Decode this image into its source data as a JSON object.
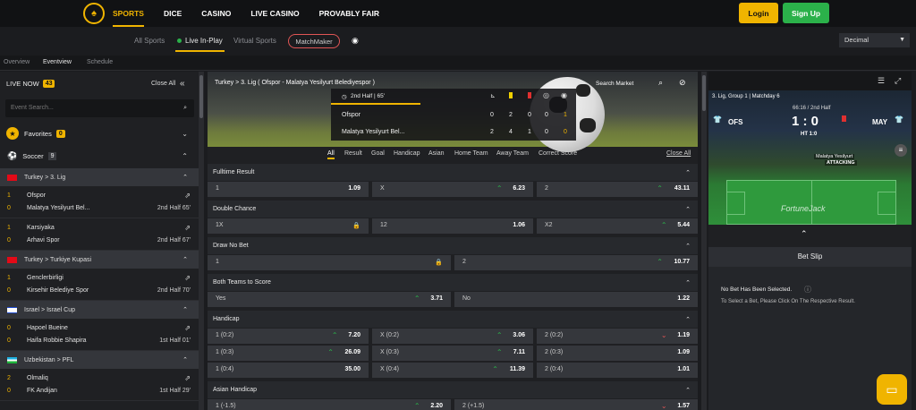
{
  "topnav": {
    "items": [
      "SPORTS",
      "DICE",
      "CASINO",
      "LIVE CASINO",
      "PROVABLY FAIR"
    ],
    "login": "Login",
    "signup": "Sign Up"
  },
  "subnav": {
    "all_sports": "All Sports",
    "live": "Live In-Play",
    "virtual": "Virtual Sports",
    "matchmaker": "MatchMaker",
    "odds_format": "Decimal"
  },
  "viewtabs": {
    "overview": "Overview",
    "eventview": "Eventview",
    "schedule": "Schedule"
  },
  "left": {
    "live_now": "LIVE NOW",
    "live_count": "43",
    "close_all": "Close All",
    "search_placeholder": "Event Search...",
    "favorites": "Favorites",
    "favorites_count": "0",
    "soccer": "Soccer",
    "soccer_count": "9",
    "leagues": [
      {
        "name": "Turkey > 3. Lig",
        "matches": [
          {
            "home": "Ofspor",
            "away": "Malatya Yesilyurt Bel...",
            "hs": "1",
            "as": "0",
            "status": "2nd Half  65'"
          },
          {
            "home": "Karsiyaka",
            "away": "Arhavi Spor",
            "hs": "1",
            "as": "0",
            "status": "2nd Half  67'"
          }
        ]
      },
      {
        "name": "Turkey > Turkiye Kupasi",
        "matches": [
          {
            "home": "Genclerbirligi",
            "away": "Kirsehir Belediye Spor",
            "hs": "1",
            "as": "0",
            "status": "2nd Half  70'"
          }
        ]
      },
      {
        "name": "Israel > Israel Cup",
        "matches": [
          {
            "home": "Hapoel Bueine",
            "away": "Haifa Robbie Shapira",
            "hs": "0",
            "as": "0",
            "status": "1st Half  01'"
          }
        ]
      },
      {
        "name": "Uzbekistan > PFL",
        "matches": [
          {
            "home": "Olmaliq",
            "away": "FK Andijan",
            "hs": "2",
            "as": "0",
            "status": "1st Half  29'"
          }
        ]
      }
    ]
  },
  "event": {
    "title": "Turkey > 3. Lig ( Ofspor - Malatya Yesilyurt Belediyespor )",
    "search_market": "Search Market",
    "period": "2nd Half | 65'",
    "teams": [
      {
        "name": "Ofspor",
        "stats": [
          "0",
          "2",
          "0",
          "0",
          "1"
        ]
      },
      {
        "name": "Malatya Yesilyurt Bel...",
        "stats": [
          "2",
          "4",
          "1",
          "0",
          "0"
        ]
      }
    ]
  },
  "market_tabs": [
    "All",
    "Result",
    "Goal",
    "Handicap",
    "Asian",
    "Home Team",
    "Away Team",
    "Correct Score"
  ],
  "close_all": "Close All",
  "markets": [
    {
      "title": "Fulltime Result",
      "rows": [
        [
          {
            "l": "1",
            "v": "1.09"
          },
          {
            "l": "X",
            "v": "6.23",
            "t": "up"
          },
          {
            "l": "2",
            "v": "43.11",
            "t": "up"
          }
        ]
      ]
    },
    {
      "title": "Double Chance",
      "rows": [
        [
          {
            "l": "1X",
            "v": "",
            "lock": true
          },
          {
            "l": "12",
            "v": "1.06"
          },
          {
            "l": "X2",
            "v": "5.44",
            "t": "up"
          }
        ]
      ]
    },
    {
      "title": "Draw No Bet",
      "rows": [
        [
          {
            "l": "1",
            "v": "",
            "lock": true
          },
          {
            "l": "2",
            "v": "10.77",
            "t": "up"
          }
        ]
      ]
    },
    {
      "title": "Both Teams to Score",
      "rows": [
        [
          {
            "l": "Yes",
            "v": "3.71",
            "t": "up"
          },
          {
            "l": "No",
            "v": "1.22"
          }
        ]
      ]
    },
    {
      "title": "Handicap",
      "rows": [
        [
          {
            "l": "1  (0:2)",
            "v": "7.20",
            "t": "up"
          },
          {
            "l": "X  (0:2)",
            "v": "3.06",
            "t": "up"
          },
          {
            "l": "2  (0:2)",
            "v": "1.19",
            "t": "down"
          }
        ],
        [
          {
            "l": "1  (0:3)",
            "v": "26.09",
            "t": "up"
          },
          {
            "l": "X  (0:3)",
            "v": "7.11",
            "t": "up"
          },
          {
            "l": "2  (0:3)",
            "v": "1.09"
          }
        ],
        [
          {
            "l": "1  (0:4)",
            "v": "35.00"
          },
          {
            "l": "X  (0:4)",
            "v": "11.39",
            "t": "up"
          },
          {
            "l": "2  (0:4)",
            "v": "1.01"
          }
        ]
      ]
    },
    {
      "title": "Asian Handicap",
      "rows": [
        [
          {
            "l": "1  (-1.5)",
            "v": "2.20",
            "t": "up"
          },
          {
            "l": "2  (+1.5)",
            "v": "1.57",
            "t": "down"
          }
        ]
      ]
    }
  ],
  "tracker": {
    "league": "3. Lig, Group 1 | Matchday 6",
    "clock": "66:16 / 2nd Half",
    "home": "OFS",
    "away": "MAY",
    "score": "1 : 0",
    "ht": "HT 1:0",
    "attacking_team": "Malatya Yesilyurt",
    "attacking": "ATTACKING",
    "brand": "FortuneJack"
  },
  "betslip": {
    "title": "Bet Slip",
    "empty": "No Bet Has Been Selected.",
    "hint": "To Select a Bet, Please Click On The Respective Result."
  }
}
